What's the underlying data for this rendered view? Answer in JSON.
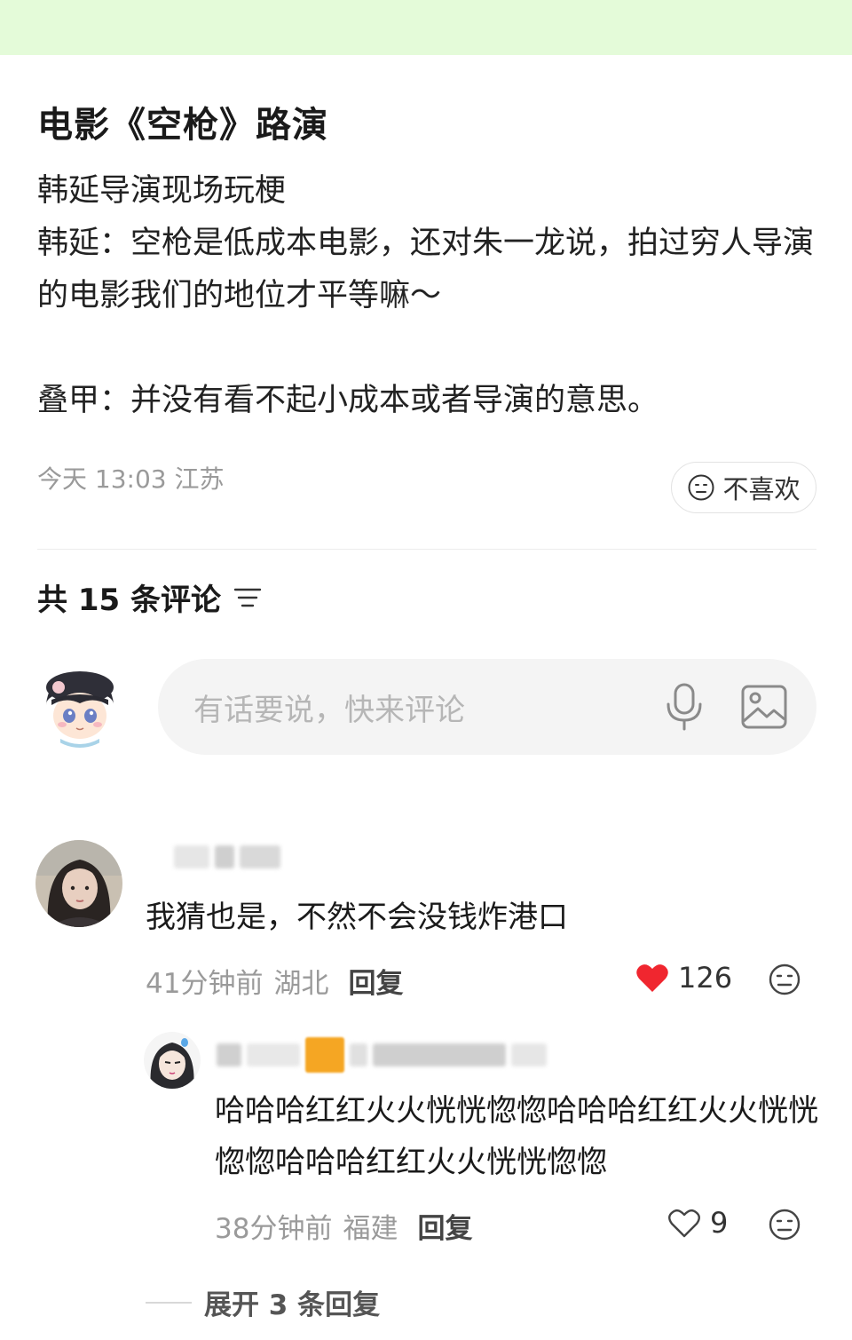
{
  "post": {
    "title": "电影《空枪》路演",
    "body": "韩延导演现场玩梗\n韩延：空枪是低成本电影，还对朱一龙说，拍过穷人导演的电影我们的地位才平等嘛～\n\n叠甲：并没有看不起小成本或者导演的意思。",
    "meta": "今天 13:03 江苏",
    "dislike_label": "不喜欢"
  },
  "comments_header": {
    "count_label": "共 15 条评论"
  },
  "composer": {
    "placeholder": "有话要说，快来评论"
  },
  "comments": [
    {
      "text": "我猜也是，不然不会没钱炸港口",
      "time": "41分钟前",
      "location": "湖北",
      "reply_label": "回复",
      "likes": "126",
      "liked": true
    },
    {
      "text": "哈哈哈红红火火恍恍惚惚哈哈哈红红火火恍恍惚惚哈哈哈红红火火恍恍惚惚",
      "time": "38分钟前",
      "location": "福建",
      "reply_label": "回复",
      "likes": "9",
      "liked": false
    }
  ],
  "expand_label": "展开 3 条回复",
  "colors": {
    "top_bar": "#e4fbd9",
    "like_red": "#f0262f",
    "meta_gray": "#9a9a9a"
  },
  "icons": [
    "sort-icon",
    "mic-icon",
    "image-icon",
    "heart-icon",
    "smile-icon",
    "neutral-face-icon"
  ]
}
